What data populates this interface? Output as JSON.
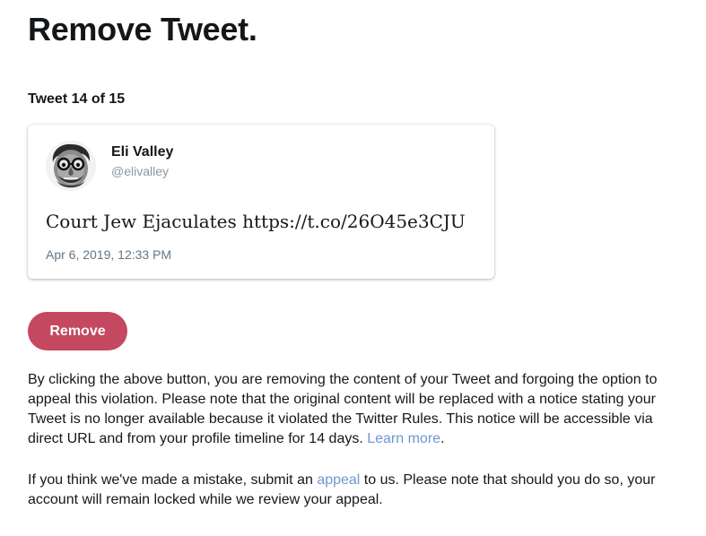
{
  "page": {
    "title": "Remove Tweet.",
    "counter": "Tweet 14 of 15"
  },
  "tweet": {
    "user_name": "Eli Valley",
    "user_handle": "@elivalley",
    "text": "Court Jew Ejaculates https://t.co/26O45e3CJU",
    "timestamp": "Apr 6, 2019, 12:33 PM",
    "avatar_icon": "caricature-avatar-icon"
  },
  "actions": {
    "remove_label": "Remove"
  },
  "info": {
    "para1_text": "By clicking the above button, you are removing the content of your Tweet and forgoing the option to appeal this violation. Please note that the original content will be replaced with a notice stating your Tweet is no longer available because it violated the Twitter Rules. This notice will be accessible via direct URL and from your profile timeline for 14 days. ",
    "learn_more_label": "Learn more",
    "para1_end": ".",
    "para2_before": "If you think we've made a mistake, submit an ",
    "appeal_label": "appeal",
    "para2_after": " to us. Please note that should you do so, your account will remain locked while we review your appeal."
  },
  "colors": {
    "remove_button": "#c4485f",
    "link": "#6f96d3",
    "handle": "#8899a6"
  }
}
